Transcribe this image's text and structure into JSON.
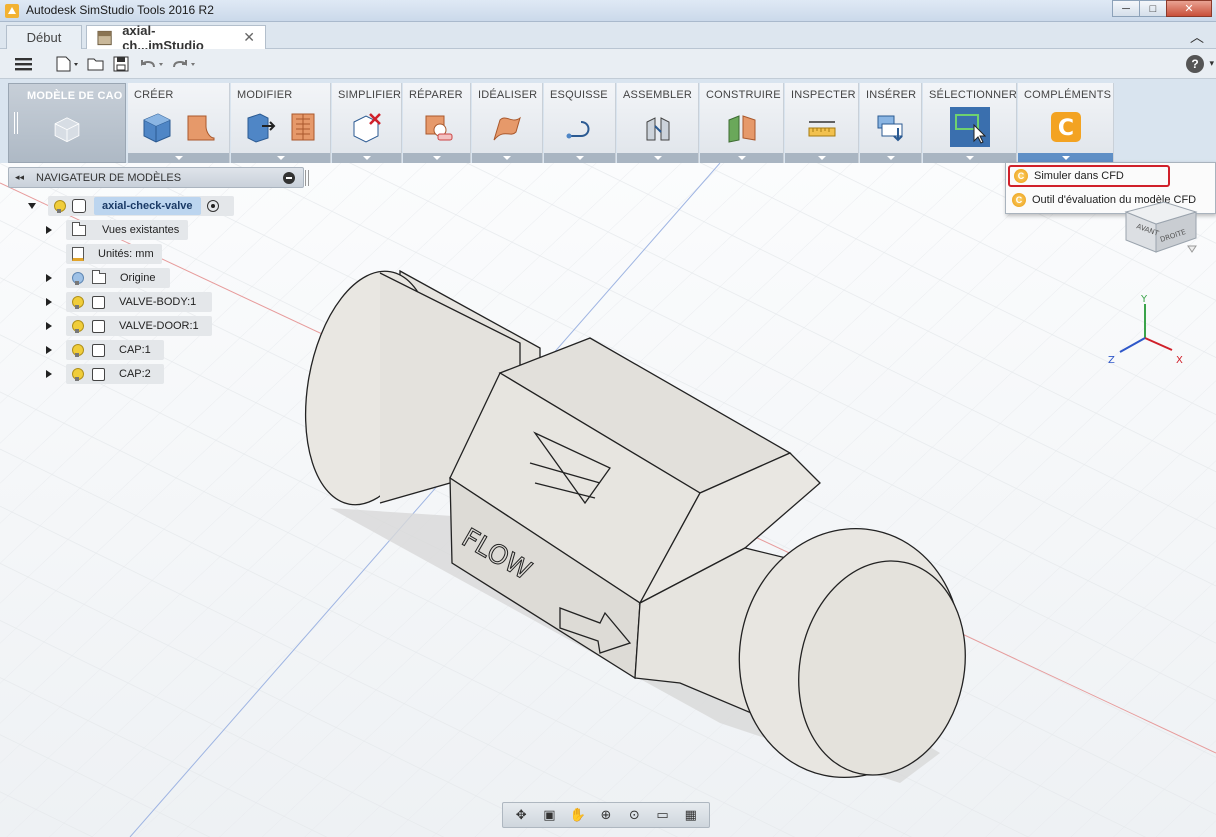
{
  "window": {
    "title": "Autodesk SimStudio Tools 2016 R2",
    "minimize": "─",
    "maximize": "□",
    "close": "✕"
  },
  "tabs": [
    {
      "label": "Début"
    },
    {
      "label": "axial-ch...imStudio"
    }
  ],
  "ribbon": {
    "workspace": "MODÈLE DE CAO",
    "groups": [
      {
        "label": "CRÉER"
      },
      {
        "label": "MODIFIER"
      },
      {
        "label": "SIMPLIFIER"
      },
      {
        "label": "RÉPARER"
      },
      {
        "label": "IDÉALISER"
      },
      {
        "label": "ESQUISSE"
      },
      {
        "label": "ASSEMBLER"
      },
      {
        "label": "CONSTRUIRE"
      },
      {
        "label": "INSPECTER"
      },
      {
        "label": "INSÉRER"
      },
      {
        "label": "SÉLECTIONNER"
      },
      {
        "label": "COMPLÉMENTS"
      }
    ]
  },
  "menu": {
    "items": [
      {
        "label": "Simuler dans CFD"
      },
      {
        "label": "Outil d'évaluation du modèle CFD"
      }
    ]
  },
  "browser": {
    "title": "NAVIGATEUR DE MODÈLES",
    "root": "axial-check-valve",
    "nodes": [
      {
        "label": "Vues existantes"
      },
      {
        "label": "Unités: mm"
      },
      {
        "label": "Origine"
      },
      {
        "label": "VALVE-BODY:1"
      },
      {
        "label": "VALVE-DOOR:1"
      },
      {
        "label": "CAP:1"
      },
      {
        "label": "CAP:2"
      }
    ]
  },
  "viewcube": {
    "front": "AVANT",
    "right": "DROITE"
  },
  "triad": {
    "x": "X",
    "y": "Y",
    "z": "Z"
  },
  "model": {
    "engraving": "FLOW"
  },
  "colors": {
    "accent": "#5f8fc6",
    "highlight_border": "#d0202a",
    "model_fill": "#e8e6e1"
  },
  "icons": {
    "menu": "hamburger-icon",
    "help": "help-icon"
  }
}
